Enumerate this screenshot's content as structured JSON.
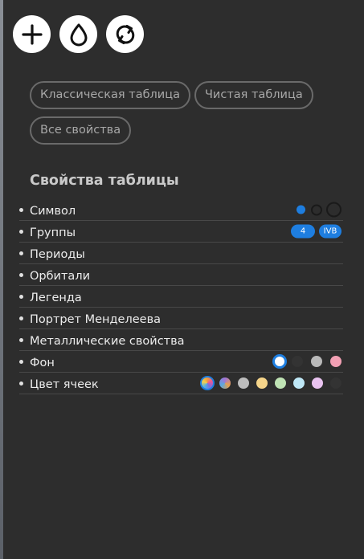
{
  "toolbar": {
    "buttons": [
      {
        "icon": "plus-icon"
      },
      {
        "icon": "drop-icon"
      },
      {
        "icon": "refresh-icon"
      }
    ]
  },
  "presets": {
    "classic": "Классическая таблица",
    "clean": "Чистая таблица",
    "all": "Все свойства"
  },
  "section_title": "Свойства таблицы",
  "properties": {
    "symbol": {
      "label": "Символ"
    },
    "groups": {
      "label": "Группы",
      "badge_number": "4",
      "badge_roman": "IVB"
    },
    "periods": {
      "label": "Периоды"
    },
    "orbitals": {
      "label": "Орбитали"
    },
    "legend": {
      "label": "Легенда"
    },
    "portrait": {
      "label": "Портрет Менделеева"
    },
    "metallic": {
      "label": "Металлические свойства"
    },
    "background": {
      "label": "Фон"
    },
    "cell_color": {
      "label": "Цвет ячеек"
    }
  },
  "colors": {
    "accent": "#1e7ee0",
    "background_swatches": [
      "#ffffff",
      "#333333",
      "#b9b9b9",
      "#f2a0b4"
    ],
    "cell_swatches": [
      "gradient-1",
      "gradient-2",
      "#bdbdbd",
      "#f6d58a",
      "#bfe3b4",
      "#bfe8f7",
      "#e9c3f0",
      "#333333"
    ]
  }
}
